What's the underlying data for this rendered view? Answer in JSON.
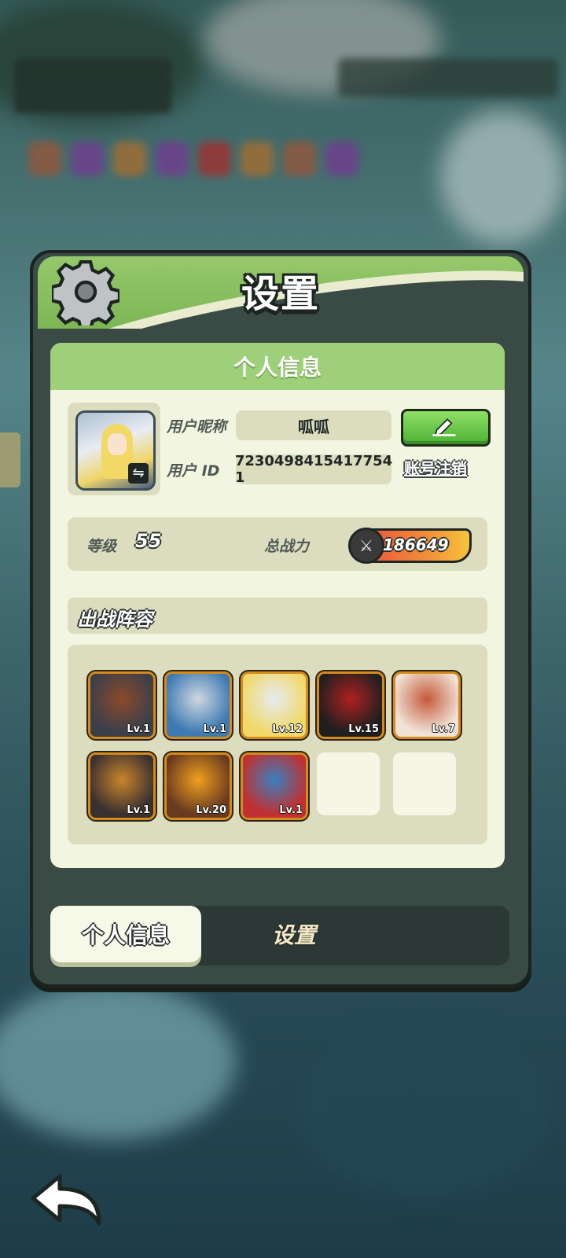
{
  "panel": {
    "title": "设置",
    "gear_icon": "gear-icon"
  },
  "card": {
    "header": "个人信息",
    "nickname_label": "用户昵称",
    "nickname": "呱呱",
    "id_label": "用户 ID",
    "user_id": "7230498415417754 1",
    "edit_icon": "pencil-icon",
    "delete_account": "账号注销"
  },
  "stats": {
    "level_label": "等级",
    "level": "55",
    "power_label": "总战力",
    "power": "186649"
  },
  "lineup": {
    "title": "出战阵容",
    "heroes": [
      {
        "level": "Lv.1",
        "colors": [
          "#3b3f4a",
          "#8b4a2a"
        ]
      },
      {
        "level": "Lv.1",
        "colors": [
          "#3d7ab3",
          "#cfd8df"
        ]
      },
      {
        "level": "Lv.12",
        "colors": [
          "#f0d96a",
          "#e7ebf2"
        ]
      },
      {
        "level": "Lv.15",
        "colors": [
          "#1f1f1f",
          "#b02020"
        ]
      },
      {
        "level": "Lv.7",
        "colors": [
          "#f0e2d6",
          "#c45a3a"
        ]
      },
      {
        "level": "Lv.1",
        "colors": [
          "#3a3030",
          "#c9862a"
        ]
      },
      {
        "level": "Lv.20",
        "colors": [
          "#6a3a20",
          "#f0a020"
        ]
      },
      {
        "level": "Lv.1",
        "colors": [
          "#c03030",
          "#3a80c0"
        ]
      }
    ],
    "empty_slots": 2
  },
  "tabs": {
    "profile": "个人信息",
    "settings": "设置"
  },
  "colors": {
    "accent_green": "#7db655",
    "card_bg": "#f2f5df",
    "hero_border": "#d58a1a"
  }
}
